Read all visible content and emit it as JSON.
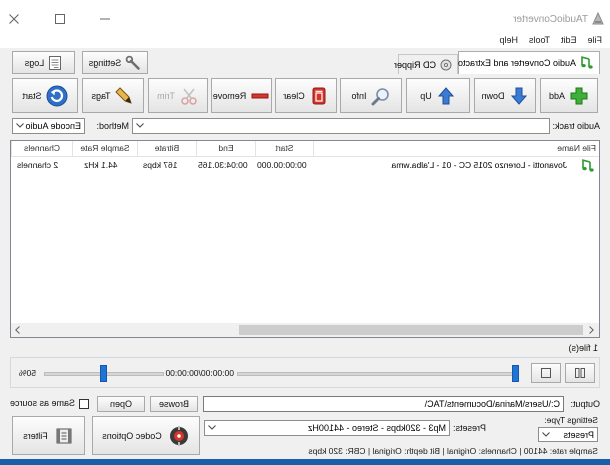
{
  "window": {
    "title": "TAudioConverter",
    "controls": [
      "minimize-icon",
      "maximize-icon",
      "close-icon"
    ]
  },
  "menu": [
    {
      "label": "File"
    },
    {
      "label": "Edit"
    },
    {
      "label": "Tools"
    },
    {
      "label": "Help"
    }
  ],
  "tabs": [
    {
      "label": "Audio Converter and Extractor",
      "icon": "music-note-icon",
      "selected": true
    },
    {
      "label": "CD Ripper",
      "icon": "cd-icon",
      "selected": false
    }
  ],
  "top_buttons": {
    "settings": {
      "label": "Settings",
      "icon": "wrench-icon"
    },
    "logs": {
      "label": "Logs",
      "icon": "notepad-icon"
    }
  },
  "toolbar": {
    "items": [
      {
        "label": "Add",
        "icon": "plus-icon",
        "enabled": true
      },
      {
        "label": "Down",
        "icon": "arrow-down-icon",
        "enabled": true
      },
      {
        "label": "Up",
        "icon": "arrow-up-icon",
        "enabled": true
      },
      {
        "label": "Info",
        "icon": "magnifier-icon",
        "enabled": true
      },
      {
        "label": "Clear",
        "icon": "clear-icon",
        "enabled": true
      },
      {
        "label": "Remove",
        "icon": "minus-icon",
        "enabled": true
      },
      {
        "label": "Trim",
        "icon": "scissors-icon",
        "enabled": false
      },
      {
        "label": "Tags",
        "icon": "pencil-icon",
        "enabled": true
      },
      {
        "label": "Start",
        "icon": "refresh-icon",
        "enabled": true
      }
    ]
  },
  "audio_track": {
    "label": "Audio track:"
  },
  "method": {
    "label": "Method:",
    "value": "Encode Audio"
  },
  "file_table": {
    "columns": [
      "File Name",
      "Start",
      "End",
      "Bitrate",
      "Sample Rate",
      "Channels"
    ],
    "rows": [
      [
        "Jovanotti - Lorenzo 2015 CC - 01 - L'alba.wma",
        "00:00:00.000",
        "00:04:30.165",
        "167 kbps",
        "44.1 kHz",
        "2 channels"
      ]
    ]
  },
  "file_count": "1 file(s)",
  "playback": {
    "time": "00:00:00/00:00:00",
    "volume": "50%",
    "seek_position": 0
  },
  "output": {
    "label": "Output:",
    "path": "C:\\Users\\Marina\\Documents\\TAC\\",
    "browse": "Browse",
    "open": "Open",
    "same_as_source": "Same as source",
    "same_as_source_checked": false
  },
  "settings_type": {
    "label": "Settings Type:",
    "value": "Presets"
  },
  "presets": {
    "label": "Presets:",
    "value": "Mp3 - 320kbps - Stereo - 44100Hz"
  },
  "action_buttons": {
    "codec_options": {
      "label": "Codec Options",
      "icon": "codec-icon"
    },
    "filters": {
      "label": "Filters",
      "icon": "filter-icon"
    }
  },
  "status_bar": "Sample rate: 44100 | Channels: Original | Bit depth: Original | CBR: 320 kbps",
  "colors": {
    "window_bg": "#f0f0f0",
    "title_bg": "#ffffff",
    "accent_green": "#2f9a2f",
    "accent_blue": "#2f6fc8",
    "accent_red": "#d6342b",
    "desktop": "#1b5ea8"
  }
}
